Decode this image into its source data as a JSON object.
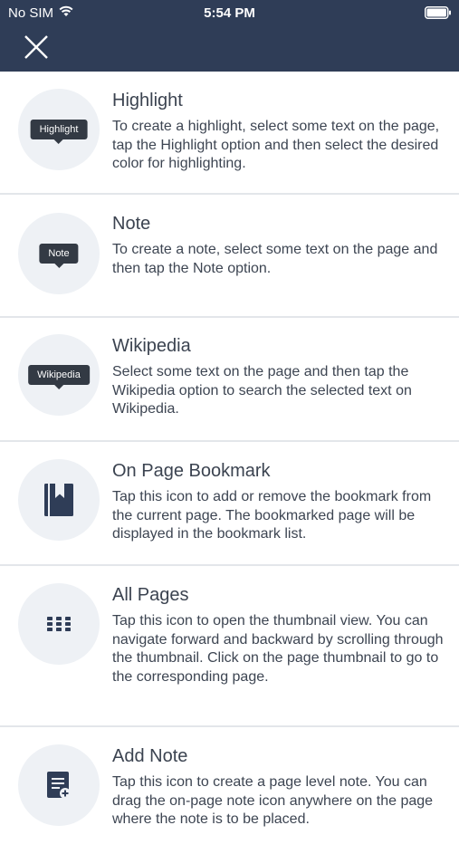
{
  "status_bar": {
    "carrier": "No SIM",
    "time": "5:54 PM",
    "wifi_icon": "wifi-icon",
    "battery_icon": "battery-icon"
  },
  "header": {
    "close_icon": "close-icon",
    "background_color": "#2f3d57"
  },
  "items": [
    {
      "title": "Highlight",
      "icon_label": "Highlight",
      "description": "To create a highlight, select some text on the page, tap the Highlight option and then select the desired color for highlighting."
    },
    {
      "title": "Note",
      "icon_label": "Note",
      "description": "To create a note, select some text on the page and then tap the Note option."
    },
    {
      "title": "Wikipedia",
      "icon_label": "Wikipedia",
      "description": "Select some text on the page and then tap the Wikipedia option to search the selected text on Wikipedia."
    },
    {
      "title": "On Page Bookmark",
      "icon": "bookmark-icon",
      "description": "Tap this icon to add or remove the bookmark from the current page. The bookmarked page will be displayed in the bookmark list."
    },
    {
      "title": "All Pages",
      "icon": "grid-icon",
      "description": "Tap this icon to open the thumbnail view. You can navigate forward and backward by scrolling through the thumbnail. Click on the page thumbnail to go to the corresponding page."
    },
    {
      "title": "Add Note",
      "icon": "add-note-icon",
      "description": "Tap this icon to create a page level note. You can drag the on-page note icon anywhere on the page where the note is to be placed."
    }
  ]
}
